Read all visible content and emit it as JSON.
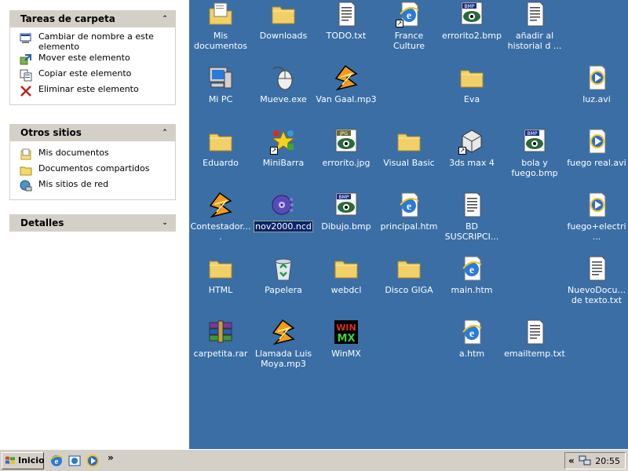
{
  "taskpane": {
    "folder_tasks": {
      "title": "Tareas de carpeta",
      "items": [
        {
          "label": "Cambiar de nombre a este elemento",
          "icon": "rename-icon"
        },
        {
          "label": "Mover este elemento",
          "icon": "move-icon"
        },
        {
          "label": "Copiar este elemento",
          "icon": "copy-icon"
        },
        {
          "label": "Eliminar este elemento",
          "icon": "delete-icon"
        }
      ]
    },
    "other_places": {
      "title": "Otros sitios",
      "items": [
        {
          "label": "Mis documentos",
          "icon": "my-documents-icon"
        },
        {
          "label": "Documentos compartidos",
          "icon": "shared-folder-icon"
        },
        {
          "label": "Mis sitios de red",
          "icon": "network-places-icon"
        }
      ]
    },
    "details": {
      "title": "Detalles"
    }
  },
  "desktop": {
    "icons": [
      {
        "label": "Mis documentos",
        "type": "mydocs"
      },
      {
        "label": "Downloads",
        "type": "folder"
      },
      {
        "label": "TODO.txt",
        "type": "txt"
      },
      {
        "label": "France Culture",
        "type": "ie",
        "shortcut": true
      },
      {
        "label": "errorito2.bmp",
        "type": "bmp"
      },
      {
        "label": "añadir al historial d ...",
        "type": "txt"
      },
      {
        "label": "Mi PC",
        "type": "mypc"
      },
      {
        "label": "Mueve.exe",
        "type": "exe"
      },
      {
        "label": "Van Gaal.mp3",
        "type": "winamp"
      },
      {
        "label": "Eva",
        "type": "folder"
      },
      {
        "label": "luz.avi",
        "type": "avi"
      },
      {
        "label": "Eduardo",
        "type": "folder"
      },
      {
        "label": "MiniBarra",
        "type": "minibarra",
        "shortcut": true
      },
      {
        "label": "errorito.jpg",
        "type": "jpg"
      },
      {
        "label": "Visual Basic",
        "type": "folder"
      },
      {
        "label": "3ds max 4",
        "type": "max",
        "shortcut": true
      },
      {
        "label": "bola y fuego.bmp",
        "type": "bmp"
      },
      {
        "label": "fuego real.avi",
        "type": "avi"
      },
      {
        "label": "Contestador....",
        "type": "winamp"
      },
      {
        "label": "nov2000.ncd",
        "type": "ncd",
        "selected": true
      },
      {
        "label": "Dibujo.bmp",
        "type": "bmp"
      },
      {
        "label": "principal.htm",
        "type": "ie"
      },
      {
        "label": "BD SUSCRIPCI...",
        "type": "txt"
      },
      {
        "label": "fuego+electri...",
        "type": "avi"
      },
      {
        "label": "HTML",
        "type": "folder"
      },
      {
        "label": "Papelera",
        "type": "recycle"
      },
      {
        "label": "webdcl",
        "type": "folder"
      },
      {
        "label": "Disco GIGA",
        "type": "folder"
      },
      {
        "label": "main.htm",
        "type": "ie"
      },
      {
        "label": "NuevoDocu... de texto.txt",
        "type": "txt"
      },
      {
        "label": "carpetita.rar",
        "type": "rar"
      },
      {
        "label": "Llamada Luis Moya.mp3",
        "type": "winamp"
      },
      {
        "label": "WinMX",
        "type": "winmx"
      },
      {
        "label": "a.htm",
        "type": "ie"
      },
      {
        "label": "emailtemp.txt",
        "type": "txt"
      }
    ]
  },
  "taskbar": {
    "start_label": "Inicio",
    "quick_launch": [
      "ie-icon",
      "outlook-icon",
      "media-player-icon"
    ],
    "overflow": "»",
    "tray_expand": "«",
    "clock": "20:55"
  }
}
